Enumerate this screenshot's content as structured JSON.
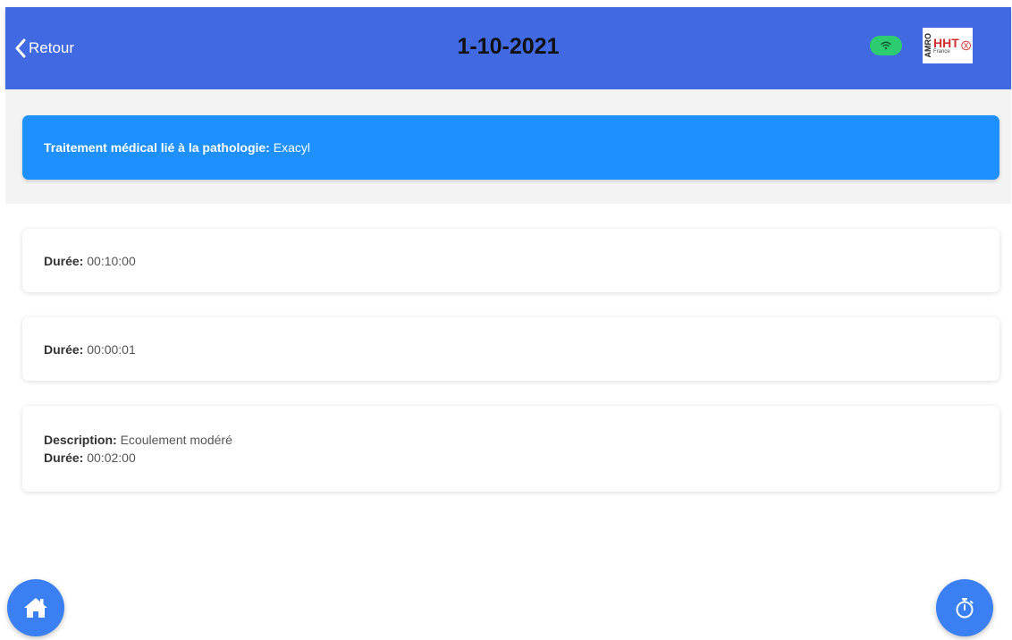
{
  "header": {
    "back_label": "Retour",
    "title": "1-10-2021",
    "wifi_icon": "wifi-icon",
    "wifi_color": "#2ecc71",
    "background": "#4169e1"
  },
  "logo": {
    "side_text": "AMRO",
    "main_text": "HHT",
    "sub_text": "France"
  },
  "banner": {
    "label": "Traitement médical lié à la pathologie:",
    "value": "Exacyl",
    "color": "#1e90ff"
  },
  "entries": [
    {
      "duration_label": "Durée:",
      "duration": "00:10:00"
    },
    {
      "duration_label": "Durée:",
      "duration": "00:00:01"
    },
    {
      "description_label": "Description:",
      "description": "Ecoulement modéré",
      "duration_label": "Durée:",
      "duration": "00:02:00"
    }
  ],
  "fabs": {
    "home_icon": "home-icon",
    "timer_icon": "stopwatch-icon",
    "color": "#3a80f2"
  }
}
